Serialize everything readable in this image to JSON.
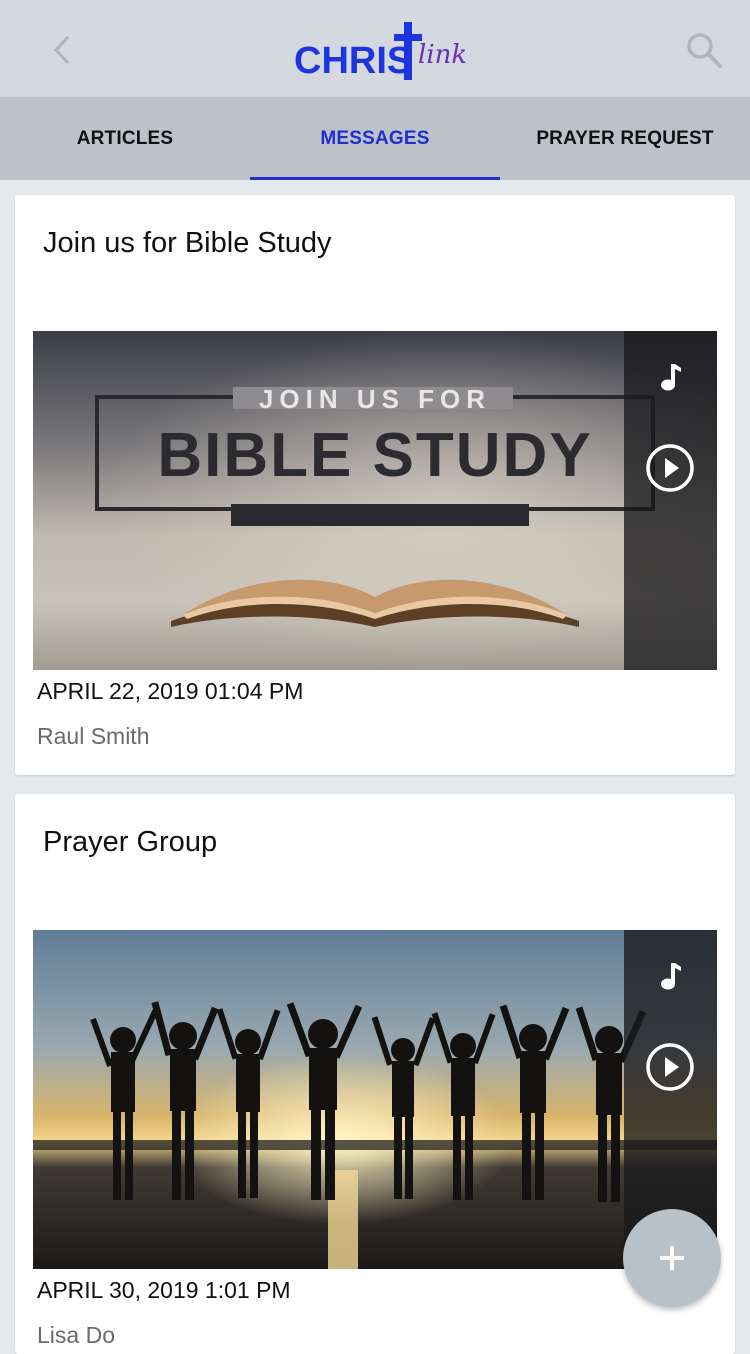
{
  "header": {
    "logo_main": "CHRIS",
    "logo_script": "link",
    "back_icon": "chevron-left-icon",
    "search_icon": "search-icon"
  },
  "tabs": [
    {
      "label": "ARTICLES",
      "active": false
    },
    {
      "label": "MESSAGES",
      "active": true
    },
    {
      "label": "PRAYER REQUEST",
      "active": false
    }
  ],
  "cards": [
    {
      "title": "Join us for Bible Study",
      "image_text_top": "JOIN US FOR",
      "image_text_main": "BIBLE STUDY",
      "date": "APRIL 22, 2019 01:04 PM",
      "author": "Raul Smith"
    },
    {
      "title": "Prayer Group",
      "date": "APRIL 30, 2019 1:01 PM",
      "author": "Lisa Do"
    }
  ],
  "fab": {
    "icon": "plus-icon"
  },
  "colors": {
    "accent": "#1f2fd0",
    "appbar": "#d3d9de",
    "tabbar": "#bcc2c7",
    "fab": "#b7c1c9"
  }
}
